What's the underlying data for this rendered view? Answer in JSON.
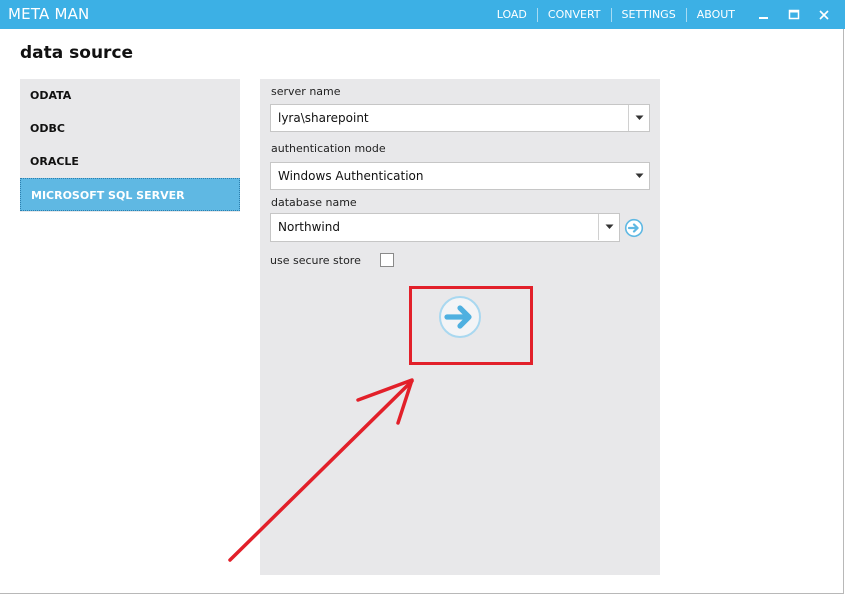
{
  "app": {
    "title": "META MAN"
  },
  "menu": [
    {
      "label": "LOAD"
    },
    {
      "label": "CONVERT"
    },
    {
      "label": "SETTINGS"
    },
    {
      "label": "ABOUT"
    }
  ],
  "page": {
    "title": "data source"
  },
  "sources": [
    {
      "label": "ODATA",
      "active": false
    },
    {
      "label": "ODBC",
      "active": false
    },
    {
      "label": "ORACLE",
      "active": false
    },
    {
      "label": "MICROSOFT SQL SERVER",
      "active": true
    }
  ],
  "form": {
    "server_name": {
      "label": "server name",
      "value": "lyra\\sharepoint"
    },
    "auth_mode": {
      "label": "authentication mode",
      "value": "Windows Authentication"
    },
    "database_name": {
      "label": "database name",
      "value": "Northwind"
    },
    "secure_store": {
      "label": "use secure store",
      "checked": false
    }
  },
  "colors": {
    "titlebar": "#3cb0e5",
    "accent": "#5fb8e3",
    "annotation": "#e2202a",
    "panel": "#e8e8ea"
  },
  "icons": {
    "next": "arrow-right-circle-icon",
    "annotation": "red-arrow-annotation"
  }
}
